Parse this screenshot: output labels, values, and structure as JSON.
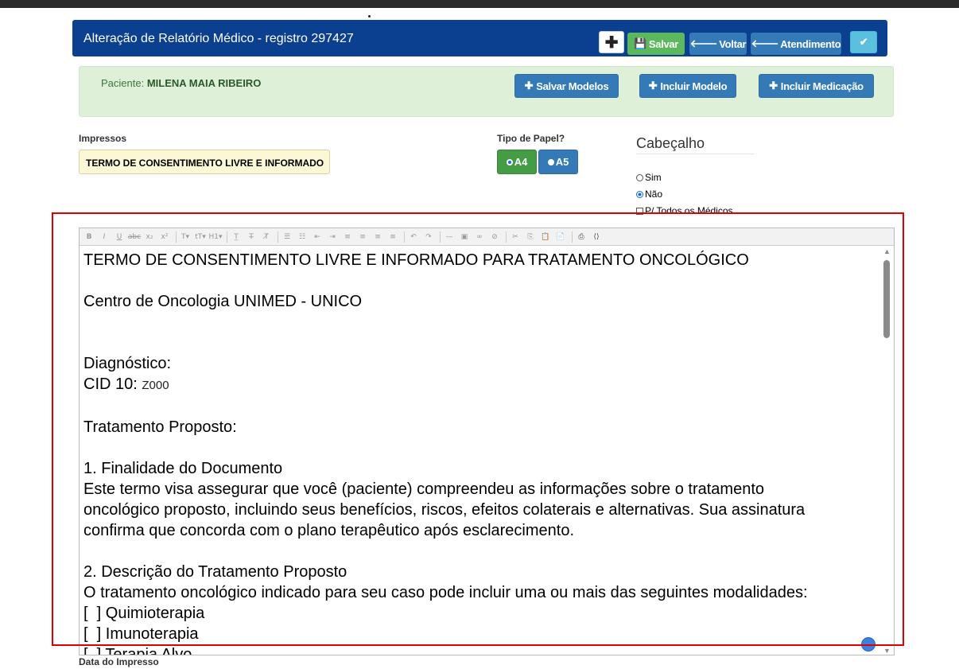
{
  "header": {
    "title": "Alteração de Relatório Médico - registro 297427",
    "plus_label": "✚",
    "salvar": "Salvar",
    "voltar": "Voltar",
    "atendimento": "Atendimento",
    "check": "✔"
  },
  "patient": {
    "label": "Paciente: ",
    "name": "MILENA MAIA RIBEIRO",
    "salvar_modelos": "Salvar Modelos",
    "incluir_modelo": "Incluir Modelo",
    "incluir_medicacao": "Incluir Medicação"
  },
  "impressos": {
    "label": "Impressos",
    "value": "TERMO DE CONSENTIMENTO LIVRE E INFORMADO"
  },
  "papel": {
    "label": "Tipo de Papel?",
    "a4": "A4",
    "a5": "A5",
    "selected": "A4"
  },
  "cabecalho": {
    "title": "Cabeçalho",
    "sim": "Sim",
    "nao": "Não",
    "todos": "P/ Todos os Médicos",
    "selected": "Não"
  },
  "editor": {
    "lines": [
      "TERMO DE CONSENTIMENTO LIVRE E INFORMADO PARA TRATAMENTO ONCOLÓGICO",
      "",
      "Centro de Oncologia UNIMED - UNICO",
      "",
      "",
      "Diagnóstico:",
      "CID 10: ",
      "",
      "Tratamento Proposto:",
      "",
      "1. Finalidade do Documento",
      "Este termo visa assegurar que você (paciente) compreendeu as informações sobre o tratamento",
      "oncológico proposto, incluindo seus benefícios, riscos, efeitos colaterais e alternativas. Sua assinatura",
      "confirma que concorda com o plano terapêutico após esclarecimento.",
      "",
      "2. Descrição do Tratamento Proposto",
      "O tratamento oncológico indicado para seu caso pode incluir uma ou mais das seguintes modalidades:",
      "[  ] Quimioterapia",
      "[  ] Imunoterapia",
      "[  ] Terapia Alvo"
    ],
    "cid_code": "Z000"
  },
  "footer": {
    "data_label": "Data do Impresso"
  },
  "colors": {
    "header_bg": "#0b3f8f",
    "success": "#5cb85c",
    "primary": "#337ab7",
    "info": "#5bc0de",
    "panel_bg": "#dff0d8",
    "highlight": "#e00000"
  }
}
